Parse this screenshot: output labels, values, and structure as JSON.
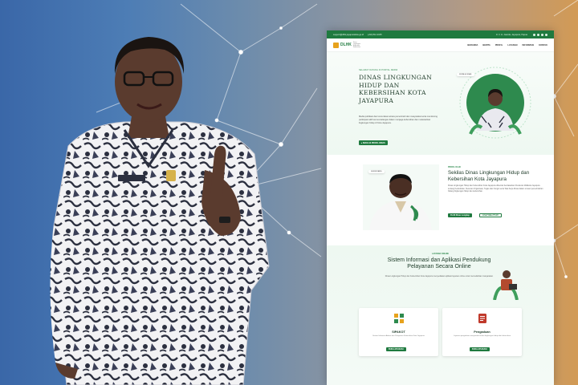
{
  "topbar": {
    "email": "support@dlhk.jayapurakota.go.id",
    "phone": "(+62) 812-2345",
    "address": "Jl. Ir. H. Juanda, Jayapura, Papua",
    "social_icons": [
      "facebook-icon",
      "twitter-icon",
      "instagram-icon",
      "youtube-icon"
    ]
  },
  "nav": {
    "logo_text": "DLHK",
    "logo_sub": "Dinas Lingkungan Hidup dan Kebersihan",
    "menu": [
      "BERANDA",
      "BERITA",
      "PROFIL",
      "LAYANAN",
      "INFORMASI",
      "KONTAK"
    ]
  },
  "hero": {
    "eyebrow": "SELAMAT DATANG DI PORTAL RESMI",
    "title": "DINAS LINGKUNGAN HIDUP DAN KEBERSIHAN KOTA JAYAPURA",
    "description": "Media publikasi dan komunikasi antara pemerintah dan masyarakat serta mendorong partisipasi aktif semua kalangan dalam menjaga kebersihan dan melestarikan lingkungan hidup di Kota Jayapura.",
    "button": "▸ SEKILAS PROFIL DINAS",
    "badge": "KEPALA DINAS"
  },
  "about": {
    "eyebrow": "PROFIL DLHK",
    "title": "Sekilas Dinas Lingkungan Hidup dan Kebersihan Kota Jayapura",
    "description": "Dinas Lingkungan Hidup dan Kebersihan Kota Jayapura dibentuk berdasarkan Peraturan Walikota Jayapura tentang Kedudukan, Susunan Organisasi, Tugas dan Fungsi serta Tata Kerja Dinas dalam urusan pemerintahan bidang lingkungan hidup dan kebersihan.",
    "button_primary": "Profil Dinas Lengkap",
    "button_secondary": "Lihat Video Profil",
    "badge": "SEKRETARIS"
  },
  "services": {
    "eyebrow": "LAYANAN ONLINE",
    "title": "Sistem Informasi dan Aplikasi Pendukung Pelayanan Secara Online",
    "description": "Dinas Lingkungan Hidup dan Kebersihan Kota Jayapura menyediakan aplikasi layanan online untuk memudahkan masyarakat.",
    "cards": [
      {
        "name": "SIPAKOT",
        "desc": "Sistem Informasi Aduan dan Pelayanan Kebersihan Kota Jayapura",
        "button": "BUKA APLIKASI",
        "icon": "grid-apps-icon"
      },
      {
        "name": "Pengaduan",
        "desc": "Layanan pengaduan masyarakat terkait lingkungan hidup dan kebersihan",
        "button": "BUKA APLIKASI",
        "icon": "complaint-icon"
      }
    ]
  },
  "colors": {
    "brand": "#1f7a3f",
    "accent": "#e7a21d"
  }
}
